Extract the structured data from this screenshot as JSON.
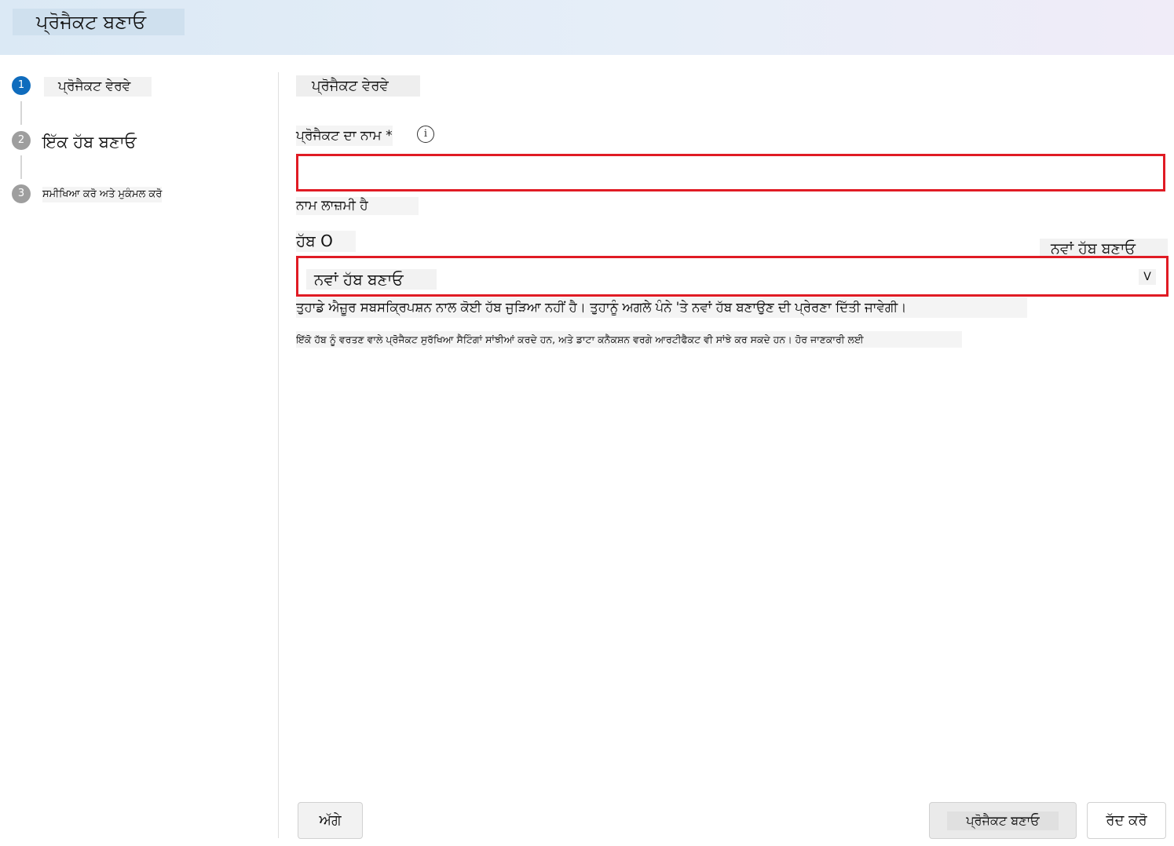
{
  "header": {
    "title": "ਪ੍ਰੋਜੈਕਟ ਬਣਾਓ"
  },
  "steps": [
    {
      "number": "1",
      "label": "ਪ੍ਰੋਜੈਕਟ ਵੇਰਵੇ",
      "state": "active"
    },
    {
      "number": "2",
      "label": "ਇੱਕ ਹੱਬ ਬਣਾਓ",
      "state": "pending"
    },
    {
      "number": "3",
      "label": "ਸਮੀਖਿਆ ਕਰੋ ਅਤੇ ਮੁਕੰਮਲ ਕਰੋ",
      "state": "pending"
    }
  ],
  "form": {
    "section_title": "ਪ੍ਰੋਜੈਕਟ ਵੇਰਵੇ",
    "name_label": "ਪ੍ਰੋਜੈਕਟ ਦਾ ਨਾਮ *",
    "name_value": "",
    "name_error": "ਨਾਮ ਲਾਜ਼ਮੀ ਹੈ",
    "hub_label": "ਹੱਬ O",
    "new_hub_link": "ਨਵਾਂ ਹੱਬ ਬਣਾਓ",
    "hub_selected": "ਨਵਾਂ ਹੱਬ ਬਣਾਓ",
    "hub_chevron": "V",
    "hub_help": "ਤੁਹਾਡੇ ਐਜ਼ੂਰ ਸਬਸਕ੍ਰਿਪਸ਼ਨ ਨਾਲ ਕੋਈ ਹੱਬ ਜੁੜਿਆ ਨਹੀਂ ਹੈ। ਤੁਹਾਨੂੰ ਅਗਲੇ ਪੰਨੇ 'ਤੇ ਨਵਾਂ ਹੱਬ ਬਣਾਉਣ ਦੀ ਪ੍ਰੇਰਣਾ ਦਿੱਤੀ ਜਾਵੇਗੀ।",
    "hub_info": "ਇੱਕੋ ਹੱਬ ਨੂੰ ਵਰਤਣ ਵਾਲੇ ਪ੍ਰੋਜੈਕਟ ਸੁਰੱਖਿਆ ਸੈਟਿੰਗਾਂ ਸਾਂਝੀਆਂ ਕਰਦੇ ਹਨ, ਅਤੇ ਡਾਟਾ ਕਨੈਕਸ਼ਨ ਵਰਗੇ ਆਰਟੀਫੈਕਟ ਵੀ ਸਾਂਝੇ ਕਰ ਸਕਦੇ ਹਨ। ਹੋਰ ਜਾਣਕਾਰੀ ਲਈ",
    "info_icon": "i"
  },
  "footer": {
    "next": "ਅੱਗੇ",
    "create": "ਪ੍ਰੋਜੈਕਟ ਬਣਾਓ",
    "cancel": "ਰੱਦ ਕਰੋ"
  },
  "colors": {
    "accent": "#0f6cbd",
    "error_border": "#e01b24",
    "step_pending": "#9e9e9e"
  }
}
